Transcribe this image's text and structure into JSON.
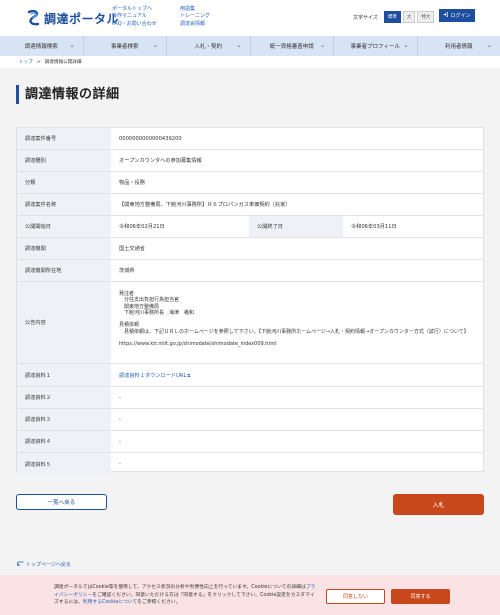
{
  "header": {
    "logo_text": "調達ポータル",
    "links_col1": [
      "ポータルトップへ",
      "操作マニュアル",
      "FAQ・お問い合わせ"
    ],
    "links_col2": [
      "用語集",
      "トレーニング",
      "調達会情報"
    ],
    "font_size_label": "文字サイズ",
    "font_sizes": [
      "標準",
      "大",
      "特大"
    ],
    "login_label": "ログイン"
  },
  "nav": {
    "items": [
      "調達情報検索",
      "事業者検索",
      "入札・契約",
      "統一資格審査申請",
      "事業者プロフィール",
      "利用者情報"
    ]
  },
  "breadcrumb": {
    "home": "トップ",
    "separator": ">",
    "current": "調達情報公開詳細"
  },
  "page": {
    "title": "調達情報の詳細"
  },
  "detail": {
    "rows": [
      {
        "label": "調達案件番号",
        "value": "0000000000000439200"
      },
      {
        "label": "調達種別",
        "value": "オープンカウンタへの参加募集情報"
      },
      {
        "label": "分類",
        "value": "物品・役務"
      },
      {
        "label": "調達案件名称",
        "value": "【関東地方整備局、下館河川事務所】Ｒ６プロパンガス単価契約（兆家）"
      }
    ],
    "date_row": {
      "start_label": "公開開始日",
      "start_value": "令和06年02月21日",
      "end_label": "公開終了日",
      "end_value": "令和06年03月11日"
    },
    "rows2": [
      {
        "label": "調達機関",
        "value": "国土交通省"
      },
      {
        "label": "調達機関所在地",
        "value": "茨城県"
      }
    ],
    "notice_label": "公告内容",
    "notice_text": "発注者\n　分任支出負担行為担当官\n　関東地方整備局\n　下館河川事務所長　海津　義和\n\n見積依頼\n　見積依頼は、下記ＵＲＬのホームページを参照して下さい。【下館河川事務所ホームページ→入札・契約情報→オープンカウンター方式（試行）について】\n\nhttps://www.ktr.mlit.go.jp/shimodate/shimodate_index009.html",
    "docs": [
      {
        "label": "調達資料１",
        "value": "調達資料１ダウンロードURL"
      },
      {
        "label": "調達資料２",
        "value": "-"
      },
      {
        "label": "調達資料３",
        "value": "-"
      },
      {
        "label": "調達資料４",
        "value": "-"
      },
      {
        "label": "調達資料５",
        "value": "-"
      }
    ]
  },
  "buttons": {
    "back": "一覧へ戻る",
    "bid": "入札"
  },
  "footer": {
    "top_link": "トップページへ戻る"
  },
  "cookie": {
    "text_before": "調達ポータルではCookie等を使用して、アクセス状況の分析や利便性向上を行っています。Cookieについての詳細は",
    "privacy_link": "プライバシーポリシー",
    "text_middle": "をご確認ください。同意いただける方は「同意する」をクリックして下さい。Cookie設定をカスタマイズするには、",
    "settings_link": "利用するCookieについて",
    "text_after": "をご参照ください。",
    "deny_label": "同意しない",
    "agree_label": "同意する"
  },
  "colors": {
    "brand_blue": "#1d4f9e",
    "accent_orange": "#c8471b",
    "nav_bg": "#d8e3f3",
    "cookie_bg": "#fbe3e5"
  }
}
